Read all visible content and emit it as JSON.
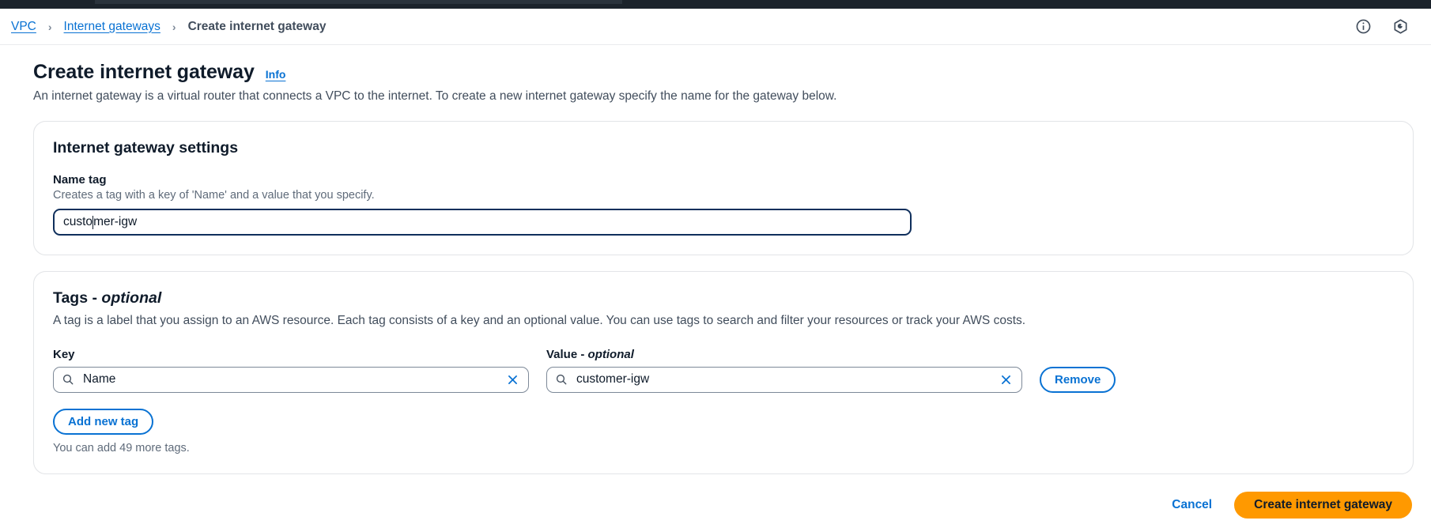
{
  "colors": {
    "link": "#0972d3",
    "primary_button": "#ff9900",
    "text": "#0f1b2a",
    "muted": "#5f6b7a",
    "top_bar": "#1b232b"
  },
  "breadcrumb": {
    "items": [
      {
        "label": "VPC",
        "type": "link"
      },
      {
        "label": "Internet gateways",
        "type": "link"
      },
      {
        "label": "Create internet gateway",
        "type": "current"
      }
    ],
    "separator": "›"
  },
  "header_icons": [
    {
      "name": "info-circle-icon",
      "title": "Info"
    },
    {
      "name": "settings-hexagon-icon",
      "title": "Settings"
    }
  ],
  "page": {
    "title": "Create internet gateway",
    "info_label": "Info",
    "description": "An internet gateway is a virtual router that connects a VPC to the internet. To create a new internet gateway specify the name for the gateway below."
  },
  "settings_card": {
    "title": "Internet gateway settings",
    "name_tag": {
      "label": "Name tag",
      "hint": "Creates a tag with a key of 'Name' and a value that you specify.",
      "value_before_caret": "custo",
      "value_after_caret": "mer-igw",
      "value": "customer-igw",
      "placeholder": ""
    }
  },
  "tags_card": {
    "title_main": "Tags",
    "title_dash": " - ",
    "title_optional": "optional",
    "description": "A tag is a label that you assign to an AWS resource. Each tag consists of a key and an optional value. You can use tags to search and filter your resources or track your AWS costs.",
    "columns": {
      "key": "Key",
      "value_main": "Value",
      "value_dash": " - ",
      "value_optional": "optional"
    },
    "rows": [
      {
        "key": "Name",
        "key_placeholder": "",
        "value": "customer-igw",
        "value_placeholder": "",
        "remove_label": "Remove"
      }
    ],
    "add_tag_label": "Add new tag",
    "note": "You can add 49 more tags."
  },
  "footer": {
    "cancel_label": "Cancel",
    "create_label": "Create internet gateway"
  }
}
